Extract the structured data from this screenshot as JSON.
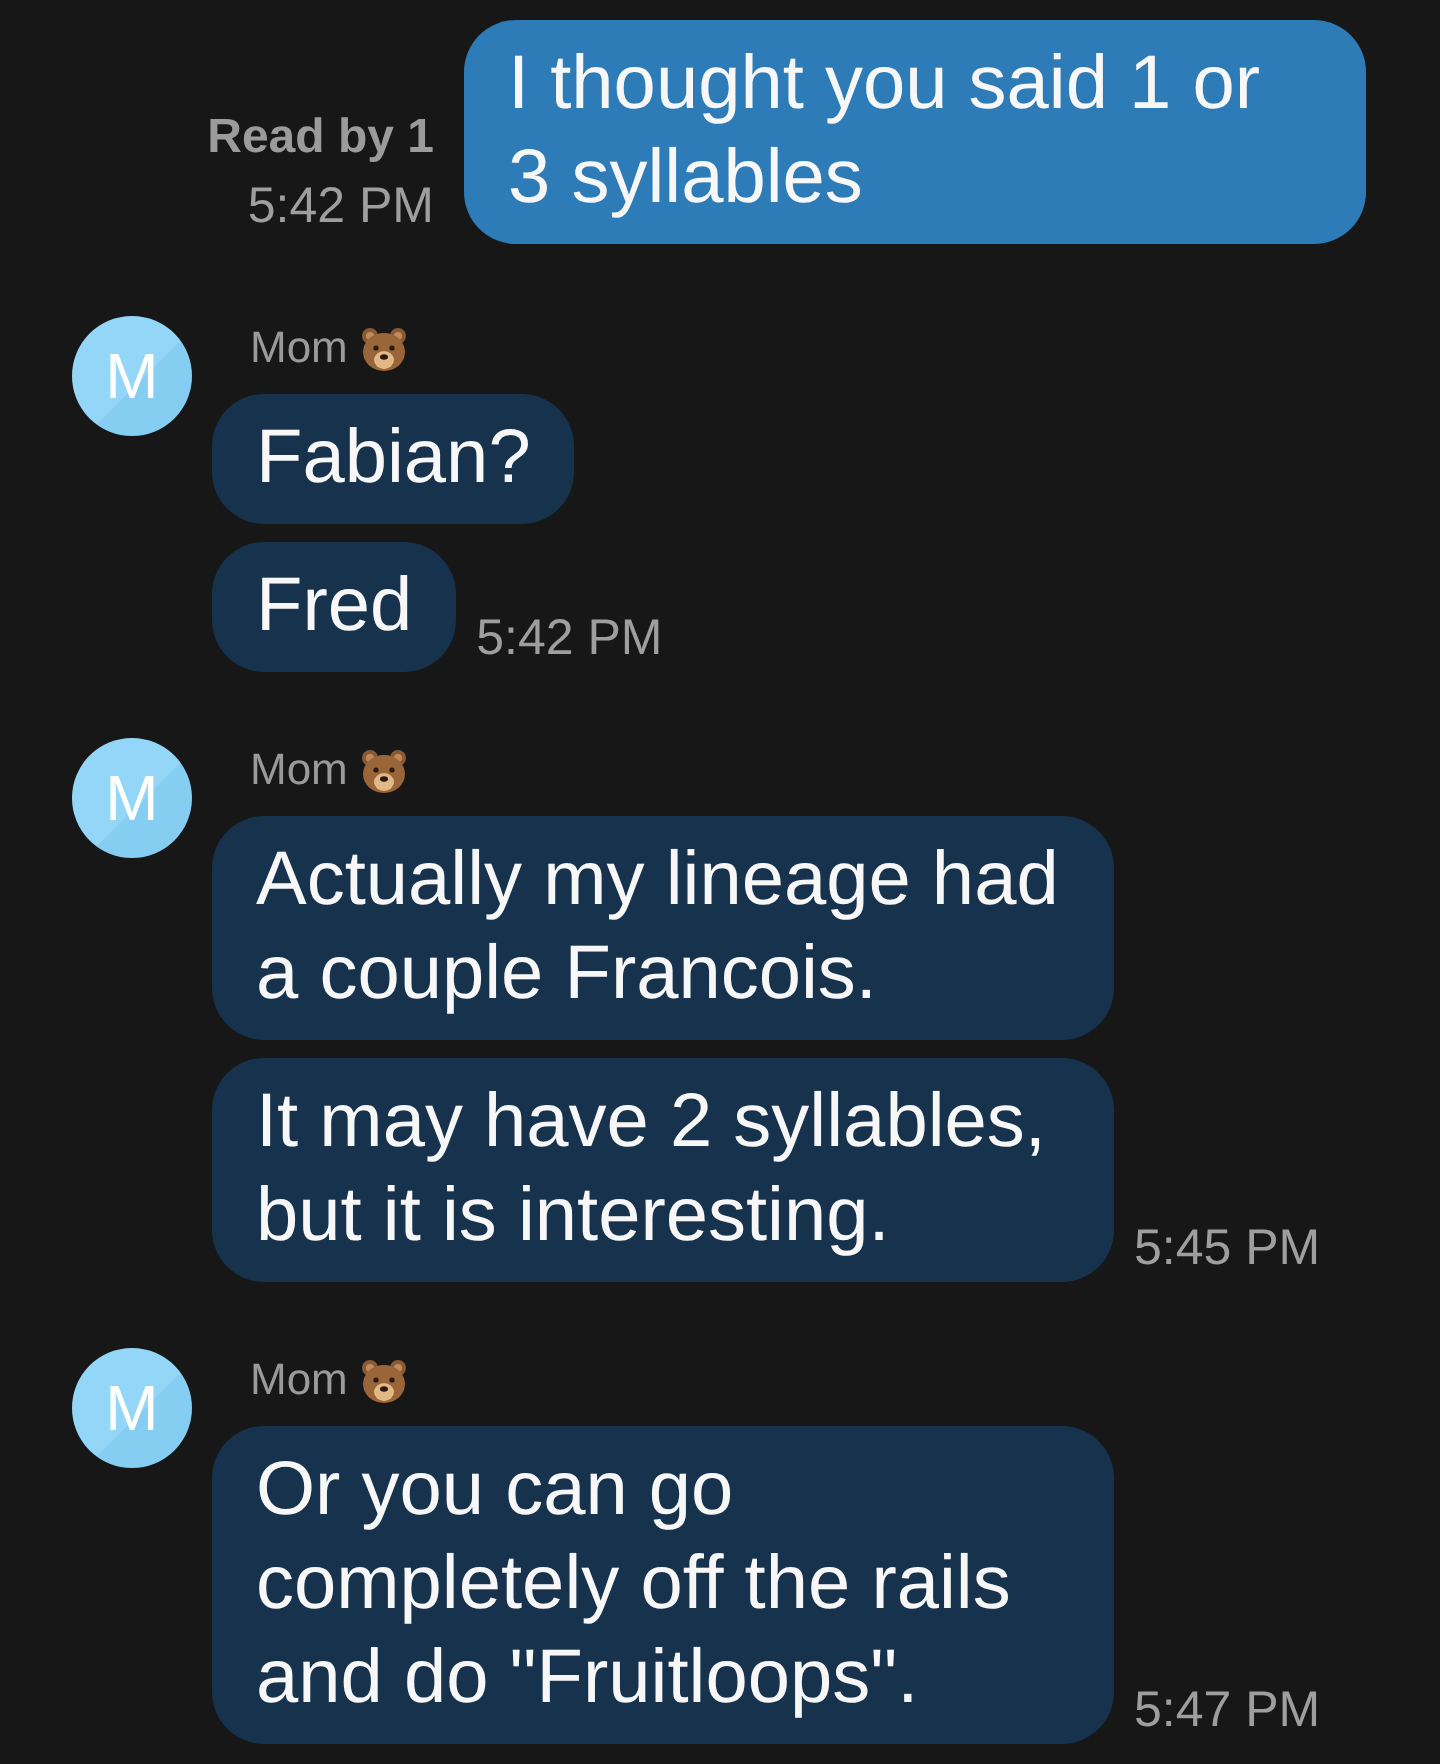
{
  "outgoing": {
    "read_receipt": "Read by 1",
    "time": "5:42 PM",
    "text": "I thought you said 1 or 3 syllables"
  },
  "groups": [
    {
      "avatar": "M",
      "sender": "Mom",
      "messages": [
        {
          "text": "Fabian?"
        },
        {
          "text": "Fred",
          "time": "5:42 PM"
        }
      ]
    },
    {
      "avatar": "M",
      "sender": "Mom",
      "messages": [
        {
          "text": "Actually my lineage had a couple Francois."
        },
        {
          "text": "It may have 2 syllables, but it is interesting.",
          "time": "5:45 PM"
        }
      ]
    },
    {
      "avatar": "M",
      "sender": "Mom",
      "messages": [
        {
          "text": "Or you can go completely off the rails and do \"Fruitloops\".",
          "time": "5:47 PM"
        }
      ]
    }
  ]
}
